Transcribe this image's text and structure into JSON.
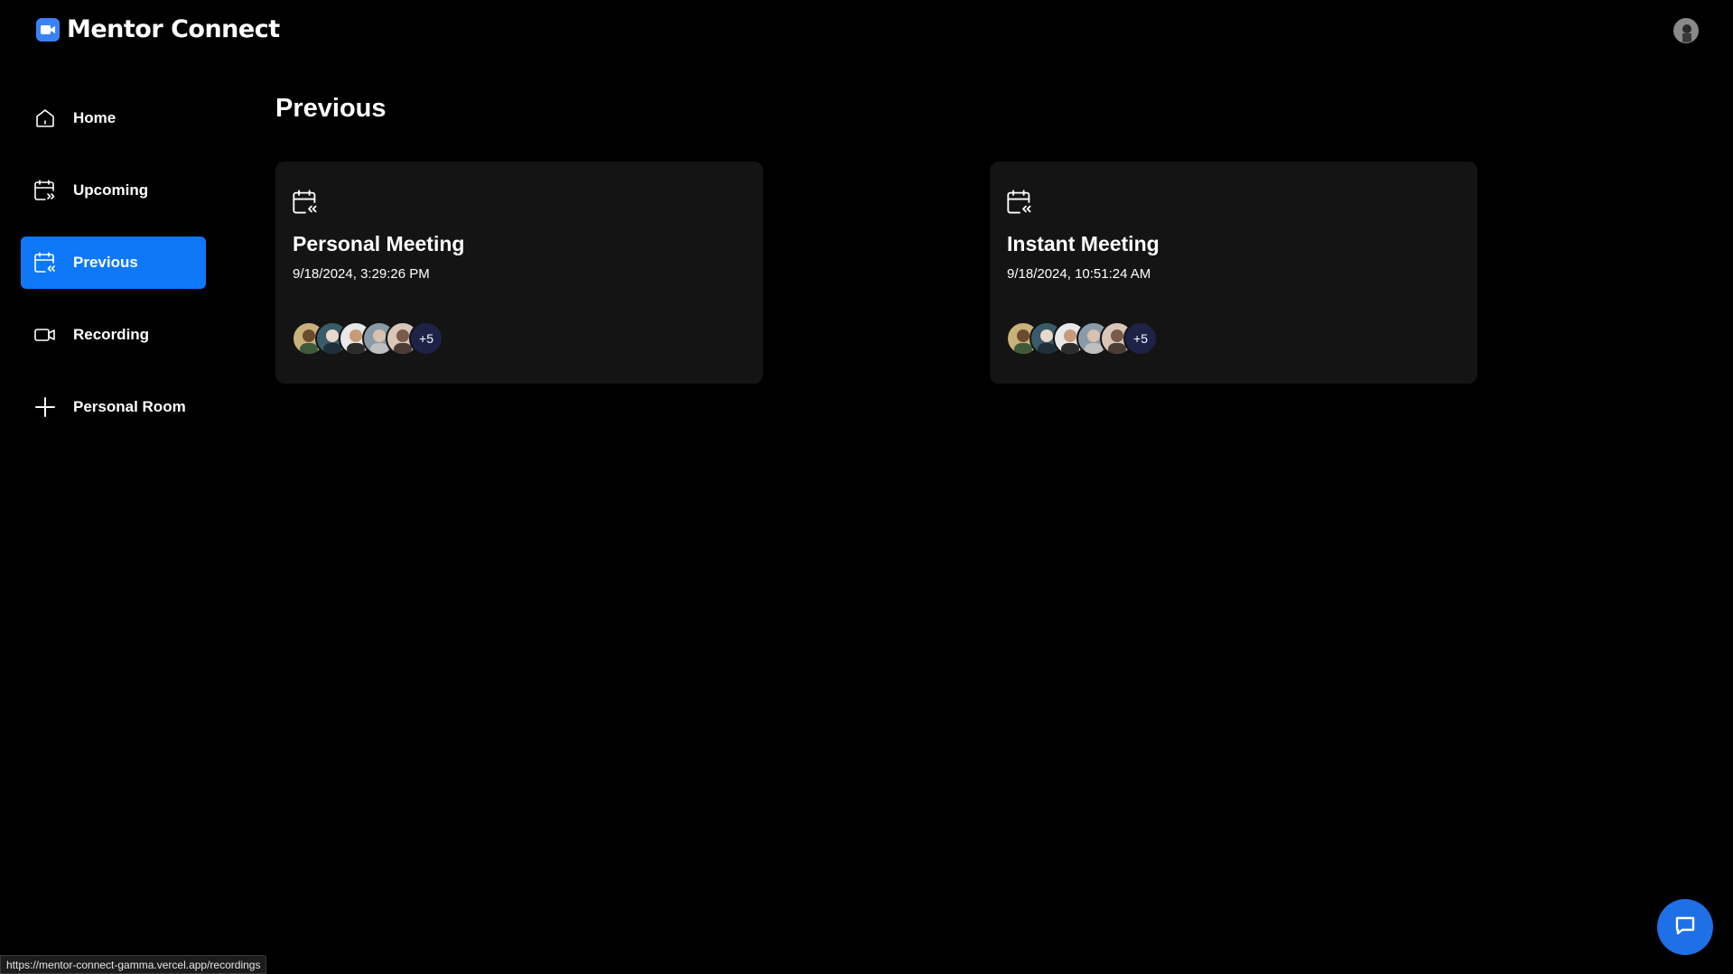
{
  "app": {
    "name": "Mentor Connect"
  },
  "sidebar": {
    "items": [
      {
        "label": "Home"
      },
      {
        "label": "Upcoming"
      },
      {
        "label": "Previous"
      },
      {
        "label": "Recording"
      },
      {
        "label": "Personal Room"
      }
    ]
  },
  "main": {
    "title": "Previous",
    "meetings": [
      {
        "title": "Personal Meeting",
        "time": "9/18/2024, 3:29:26 PM",
        "more": "+5"
      },
      {
        "title": "Instant Meeting",
        "time": "9/18/2024, 10:51:24 AM",
        "more": "+5"
      }
    ]
  },
  "status_bar": {
    "url": "https://mentor-connect-gamma.vercel.app/recordings"
  },
  "colors": {
    "accent": "#0e78f9",
    "card_bg": "#141414",
    "background": "#000000"
  }
}
